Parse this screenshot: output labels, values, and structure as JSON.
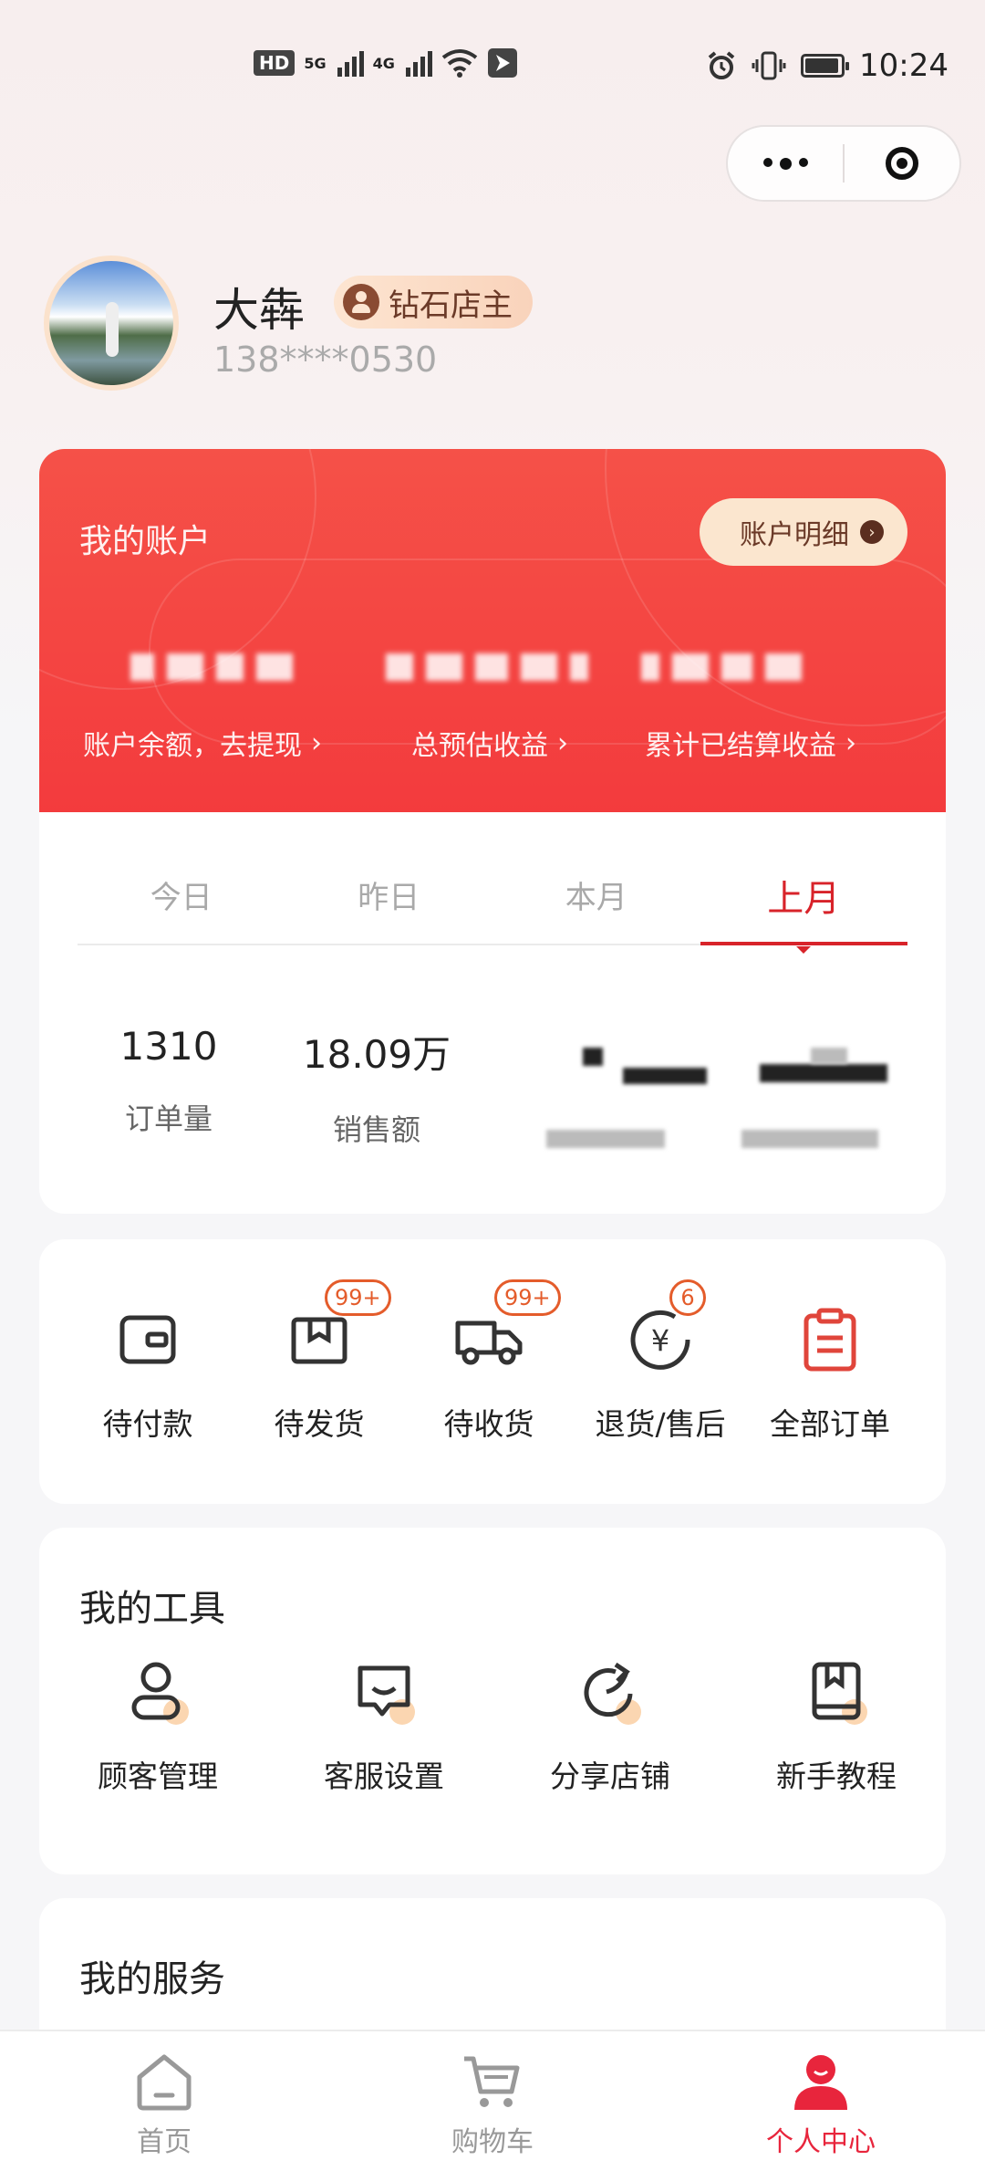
{
  "status_bar": {
    "time": "10:24",
    "left_icons": [
      "hd-icon",
      "signal-5g-icon",
      "signal-4g-icon",
      "wifi-icon",
      "location-icon"
    ],
    "hd_label": "HD",
    "sig1_label": "5G",
    "sig2_label": "4G",
    "right_icons": [
      "alarm-icon",
      "vibrate-icon",
      "battery-icon"
    ],
    "battery_level": 0.85
  },
  "capsule": {
    "more_icon": "more-dots-icon",
    "close_icon": "target-icon"
  },
  "profile": {
    "name": "大犇",
    "level": "钻石店主",
    "phone": "138****0530"
  },
  "account": {
    "title": "我的账户",
    "detail_button": "账户明细",
    "items": [
      {
        "label": "账户余额，去提现"
      },
      {
        "label": "总预估收益"
      },
      {
        "label": "累计已结算收益"
      }
    ]
  },
  "stats": {
    "tabs": [
      "今日",
      "昨日",
      "本月",
      "上月"
    ],
    "active_tab": "上月",
    "items": [
      {
        "value": "1310",
        "label": "订单量"
      },
      {
        "value": "18.09万",
        "label": "销售额"
      }
    ]
  },
  "orders": {
    "items": [
      {
        "label": "待付款",
        "icon": "wallet-icon"
      },
      {
        "label": "待发货",
        "icon": "package-icon",
        "badge": "99+"
      },
      {
        "label": "待收货",
        "icon": "truck-icon",
        "badge": "99+"
      },
      {
        "label": "退货/售后",
        "icon": "refund-icon",
        "badge": "6"
      },
      {
        "label": "全部订单",
        "icon": "clipboard-icon"
      }
    ]
  },
  "tools": {
    "title": "我的工具",
    "items": [
      {
        "label": "顾客管理",
        "icon": "customer-icon"
      },
      {
        "label": "客服设置",
        "icon": "chat-icon"
      },
      {
        "label": "分享店铺",
        "icon": "share-icon"
      },
      {
        "label": "新手教程",
        "icon": "book-icon"
      }
    ]
  },
  "services": {
    "title": "我的服务"
  },
  "nav": {
    "items": [
      {
        "label": "首页",
        "icon": "home-icon"
      },
      {
        "label": "购物车",
        "icon": "cart-icon"
      },
      {
        "label": "个人中心",
        "icon": "profile-icon"
      }
    ],
    "active": "个人中心"
  },
  "colors": {
    "accent": "#d8232a",
    "card_red": "#f33b3d",
    "badge_orange": "#e45c2b",
    "level_badge": "#fbe6cf"
  }
}
